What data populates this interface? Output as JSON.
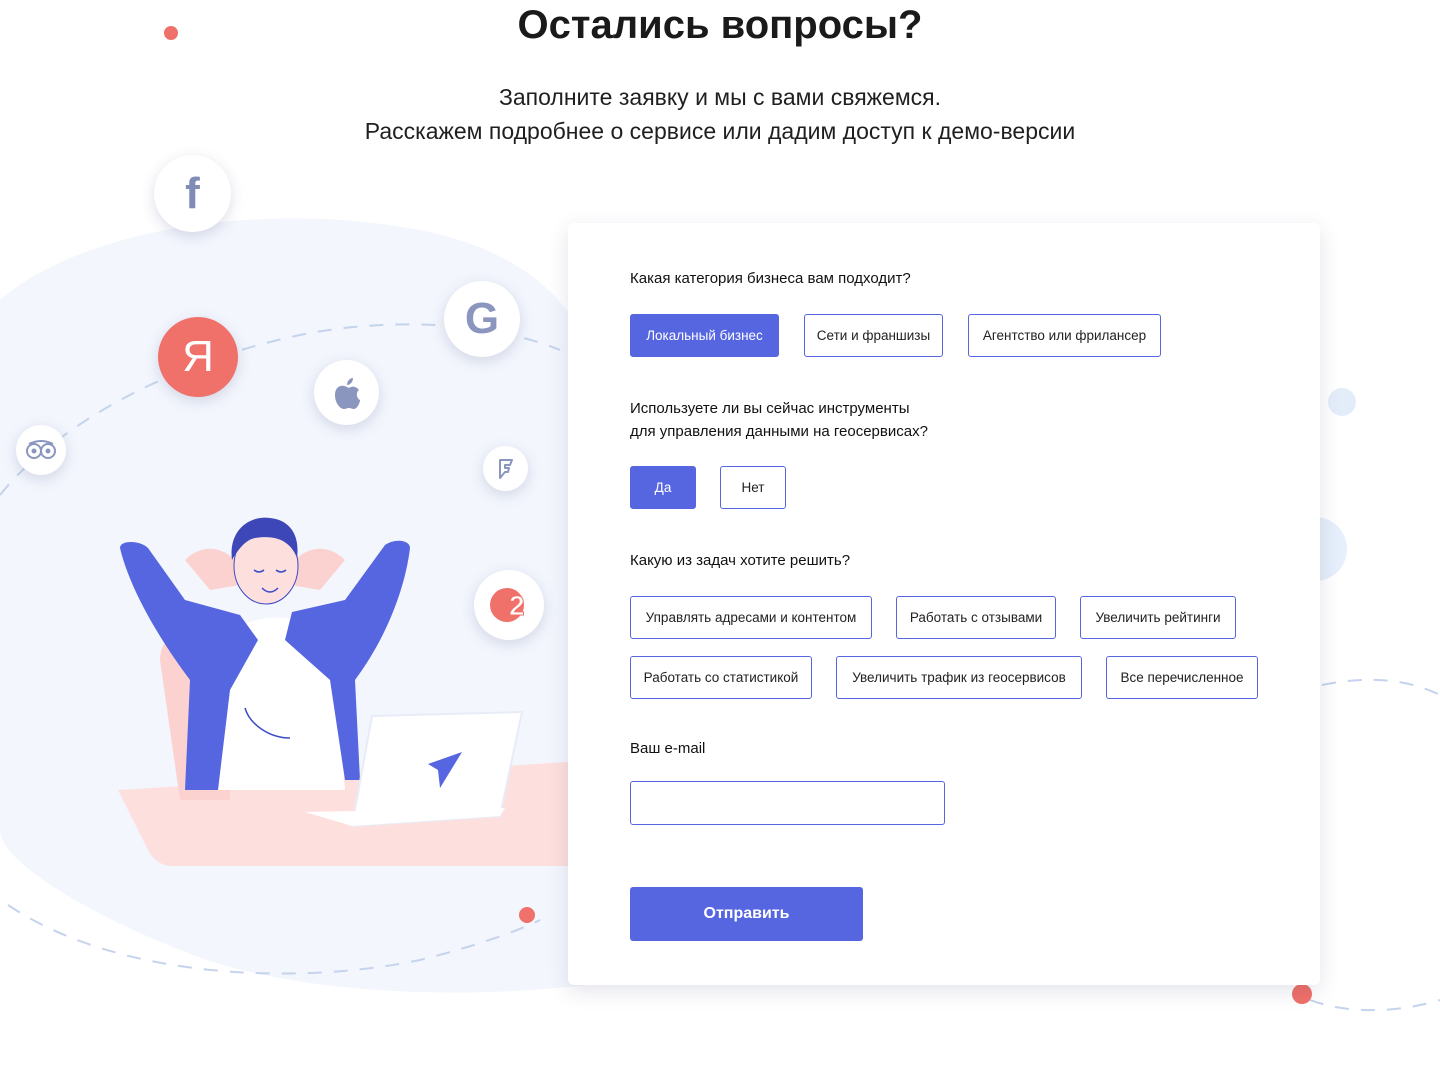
{
  "header": {
    "title": "Остались вопросы?",
    "subtitle_line1": "Заполните заявку и мы с вами свяжемся.",
    "subtitle_line2": "Расскажем подробнее о сервисе или дадим доступ к демо-версии"
  },
  "social_icons": {
    "facebook": "f",
    "google": "G",
    "yandex": "Я",
    "apple": "apple-icon",
    "tripadvisor": "tripadvisor-icon",
    "foursquare": "foursquare-icon",
    "twogis": "2"
  },
  "form": {
    "q1": {
      "label": "Какая категория бизнеса вам подходит?",
      "options": [
        "Локальный бизнес",
        "Сети и франшизы",
        "Агентство или фрилансер"
      ],
      "selected": "Локальный бизнес"
    },
    "q2": {
      "label_line1": "Используете ли вы сейчас инструменты",
      "label_line2": "для управления данными на геосервисах?",
      "options": [
        "Да",
        "Нет"
      ],
      "selected": "Да"
    },
    "q3": {
      "label": "Какую из задач хотите решить?",
      "options": [
        "Управлять адресами и контентом",
        "Работать с отзывами",
        "Увеличить рейтинги",
        "Работать со статистикой",
        "Увеличить трафик из геосервисов",
        "Все перечисленное"
      ]
    },
    "email": {
      "label": "Ваш e-mail",
      "value": "",
      "placeholder": ""
    },
    "submit_label": "Отправить"
  },
  "colors": {
    "accent": "#5666e0",
    "coral": "#f0706a",
    "blob": "#f3f6fd",
    "desk": "#fde0de"
  }
}
